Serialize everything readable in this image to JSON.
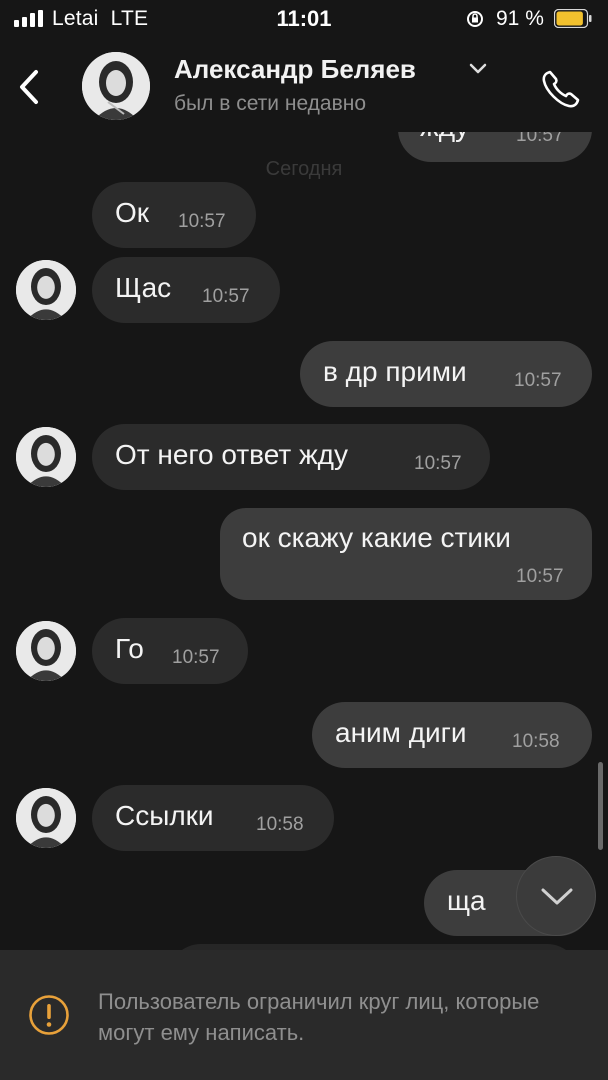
{
  "status_bar": {
    "carrier": "Letai",
    "network": "LTE",
    "time": "11:01",
    "battery_percent": "91 %",
    "battery_level": 0.91,
    "battery_color": "#f2c12e"
  },
  "header": {
    "name": "Александр Беляев",
    "status": "был в сети недавно",
    "icons": [
      "back-chevron-icon",
      "chevron-down-icon",
      "phone-icon"
    ]
  },
  "chat": {
    "date_separator": "Сегодня",
    "partial_top": {
      "text": "жду",
      "time": "10:57"
    },
    "messages": [
      {
        "dir": "in",
        "text": "Ок",
        "time": "10:57",
        "avatar": false
      },
      {
        "dir": "in",
        "text": "Щас",
        "time": "10:57",
        "avatar": true
      },
      {
        "dir": "out",
        "text": "в др прими",
        "time": "10:57"
      },
      {
        "dir": "in",
        "text": "От него ответ жду",
        "time": "10:57",
        "avatar": true
      },
      {
        "dir": "out",
        "text": "ок скажу какие стики",
        "time": "10:57"
      },
      {
        "dir": "in",
        "text": "Го",
        "time": "10:57",
        "avatar": true
      },
      {
        "dir": "out",
        "text": "аним диги",
        "time": "10:58"
      },
      {
        "dir": "in",
        "text": "Ссылки",
        "time": "10:58",
        "avatar": true
      },
      {
        "dir": "out",
        "text": "ща",
        "time": ""
      }
    ]
  },
  "footer": {
    "notice": "Пользователь ограничил круг лиц, которые могут ему написать.",
    "icon": "warning-circle-icon",
    "icon_color": "#e8a13a"
  },
  "colors": {
    "background": "#161616",
    "incoming_bubble": "#2b2b2b",
    "outgoing_bubble": "#3d3d3d"
  }
}
